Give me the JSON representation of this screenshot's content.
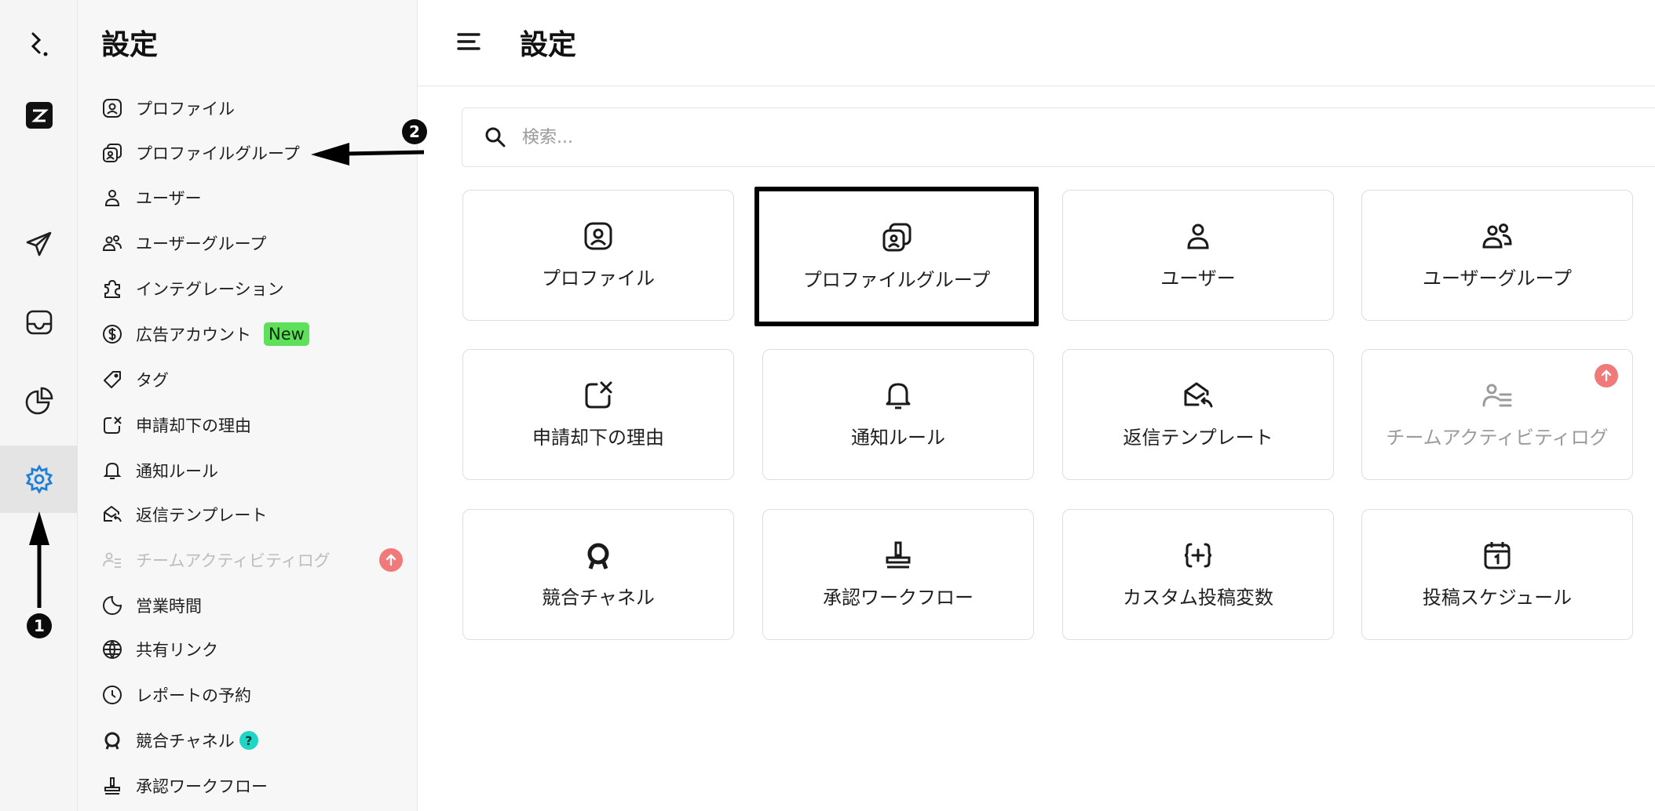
{
  "sidebar": {
    "title": "設定",
    "items": [
      {
        "label": "プロファイル",
        "icon": "profile-icon"
      },
      {
        "label": "プロファイルグループ",
        "icon": "profile-group-icon"
      },
      {
        "label": "ユーザー",
        "icon": "user-icon"
      },
      {
        "label": "ユーザーグループ",
        "icon": "user-group-icon"
      },
      {
        "label": "インテグレーション",
        "icon": "puzzle-icon"
      },
      {
        "label": "広告アカウント",
        "icon": "dollar-icon",
        "badge": "New"
      },
      {
        "label": "タグ",
        "icon": "tag-icon"
      },
      {
        "label": "申請却下の理由",
        "icon": "reject-icon"
      },
      {
        "label": "通知ルール",
        "icon": "bell-icon"
      },
      {
        "label": "返信テンプレート",
        "icon": "reply-template-icon"
      },
      {
        "label": "チームアクティビティログ",
        "icon": "team-activity-icon",
        "disabled": true
      },
      {
        "label": "営業時間",
        "icon": "moon-icon"
      },
      {
        "label": "共有リンク",
        "icon": "globe-icon"
      },
      {
        "label": "レポートの予約",
        "icon": "clock-icon"
      },
      {
        "label": "競合チャネル",
        "icon": "competitor-icon",
        "badge": "?"
      },
      {
        "label": "承認ワークフロー",
        "icon": "stamp-icon"
      }
    ]
  },
  "header": {
    "title": "設定"
  },
  "search": {
    "placeholder": "検索..."
  },
  "cards": [
    {
      "label": "プロファイル",
      "icon": "profile-icon"
    },
    {
      "label": "プロファイルグループ",
      "icon": "profile-group-icon",
      "highlighted": true
    },
    {
      "label": "ユーザー",
      "icon": "user-icon"
    },
    {
      "label": "ユーザーグループ",
      "icon": "user-group-icon"
    },
    {
      "label": "申請却下の理由",
      "icon": "reject-icon"
    },
    {
      "label": "通知ルール",
      "icon": "bell-icon"
    },
    {
      "label": "返信テンプレート",
      "icon": "reply-template-icon"
    },
    {
      "label": "チームアクティビティログ",
      "icon": "team-activity-icon",
      "disabled": true
    },
    {
      "label": "競合チャネル",
      "icon": "competitor-icon"
    },
    {
      "label": "承認ワークフロー",
      "icon": "stamp-icon"
    },
    {
      "label": "カスタム投稿変数",
      "icon": "custom-variable-icon"
    },
    {
      "label": "投稿スケジュール",
      "icon": "calendar-icon"
    }
  ],
  "annotations": {
    "marker1": "1",
    "marker2": "2"
  },
  "colors": {
    "active_settings_icon": "#1e7fd6",
    "new_badge": "#5ee05a",
    "help_badge": "#1fd6c4",
    "upgrade_dot": "#f07a7a"
  }
}
